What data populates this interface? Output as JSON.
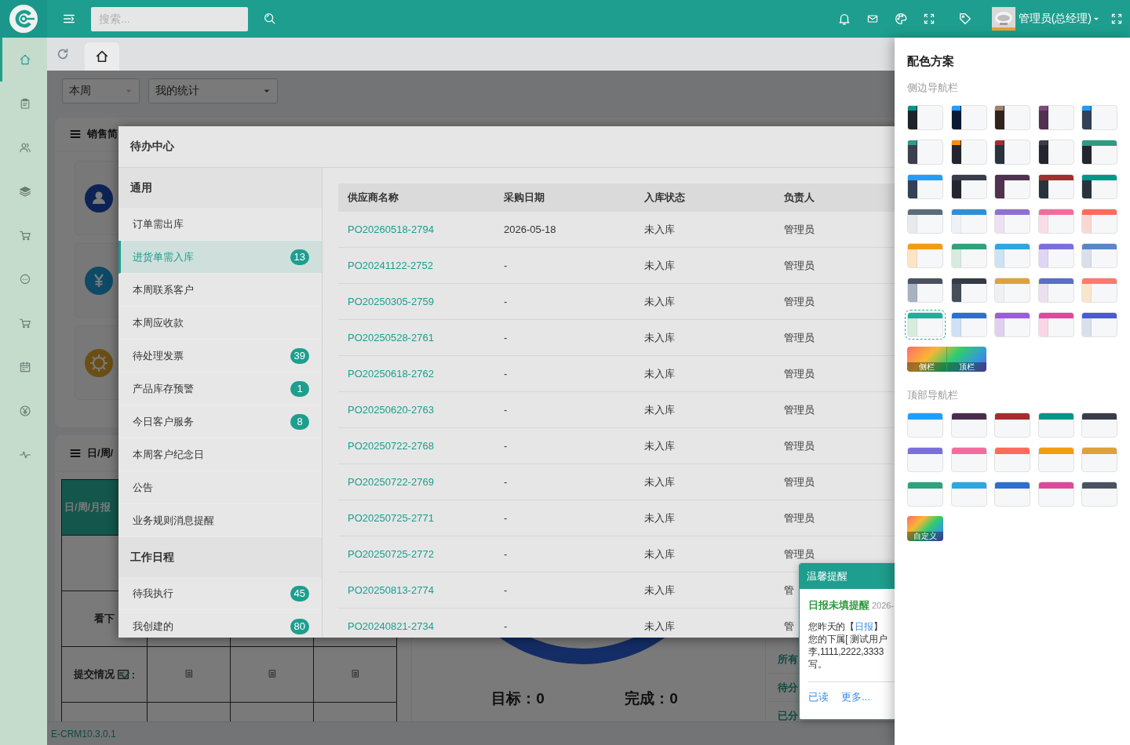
{
  "topbar": {
    "search": {
      "placeholder": "搜索..."
    },
    "user": {
      "name": "管理员(总经理)"
    }
  },
  "sidebar": {
    "items": [
      {
        "selected": true
      },
      {
        "selected": false
      },
      {
        "selected": false
      },
      {
        "selected": false
      },
      {
        "selected": false
      },
      {
        "selected": false
      },
      {
        "selected": false
      },
      {
        "selected": false
      },
      {
        "selected": false
      },
      {
        "selected": false
      }
    ]
  },
  "tabs": [
    {
      "selected": true
    }
  ],
  "dashboard": {
    "filters": [
      {
        "value": "本周"
      },
      {
        "value": "我的统计"
      }
    ],
    "sales_card": {
      "title": "销售简"
    },
    "report_card": {
      "title": "日/周/",
      "table": {
        "header": "日/周/月报",
        "rows": [
          {
            "label": "看下"
          },
          {
            "label": "提交情况",
            "suffix": ":"
          }
        ]
      },
      "target": "目标：0",
      "done": "完成：0",
      "list": [
        "所有",
        "待分",
        "已分"
      ]
    }
  },
  "footer": {
    "version": "E-CRM10.3.0.1"
  },
  "todo_dialog": {
    "title": "待办中心",
    "nav": [
      {
        "group": "通用",
        "items": [
          {
            "label": "订单需出库",
            "selected": false
          },
          {
            "label": "进货单需入库",
            "selected": true,
            "count": "13"
          },
          {
            "label": "本周联系客户",
            "selected": false
          },
          {
            "label": "本周应收款",
            "selected": false
          },
          {
            "label": "待处理发票",
            "selected": false,
            "count": "39"
          },
          {
            "label": "产品库存预警",
            "selected": false,
            "count": "1"
          },
          {
            "label": "今日客户服务",
            "selected": false,
            "count": "8"
          },
          {
            "label": "本周客户纪念日",
            "selected": false
          },
          {
            "label": "公告",
            "selected": false
          },
          {
            "label": "业务规则消息提醒",
            "selected": false
          }
        ]
      },
      {
        "group": "工作日程",
        "items": [
          {
            "label": "待我执行",
            "selected": false,
            "count": "45"
          },
          {
            "label": "我创建的",
            "selected": false,
            "count": "80"
          }
        ]
      }
    ],
    "table": {
      "columns": [
        "供应商名称",
        "采购日期",
        "入库状态",
        "负责人"
      ],
      "rows": [
        [
          "PO20260518-2794",
          "2026-05-18",
          "未入库",
          "管理员"
        ],
        [
          "PO20241122-2752",
          "-",
          "未入库",
          "管理员"
        ],
        [
          "PO20250305-2759",
          "-",
          "未入库",
          "管理员"
        ],
        [
          "PO20250528-2761",
          "-",
          "未入库",
          "管理员"
        ],
        [
          "PO20250618-2762",
          "-",
          "未入库",
          "管理员"
        ],
        [
          "PO20250620-2763",
          "-",
          "未入库",
          "管理员"
        ],
        [
          "PO20250722-2768",
          "-",
          "未入库",
          "管理员"
        ],
        [
          "PO20250722-2769",
          "-",
          "未入库",
          "管理员"
        ],
        [
          "PO20250725-2771",
          "-",
          "未入库",
          "管理员"
        ],
        [
          "PO20250725-2772",
          "-",
          "未入库",
          "管理员"
        ],
        [
          "PO20250813-2774",
          "-",
          "未入库",
          "管"
        ],
        [
          "PO20240821-2734",
          "-",
          "未入库",
          "管"
        ]
      ]
    }
  },
  "theme_panel": {
    "title": "配色方案",
    "side_label": "侧边导航栏",
    "side_swatches": [
      {
        "kind": "corner",
        "color": "#009688",
        "sidebar": {
          "color": "#20222a"
        },
        "selected": false
      },
      {
        "kind": "corner",
        "color": "#1e9fff",
        "sidebar": {
          "color": "#0a1a33"
        },
        "selected": false
      },
      {
        "kind": "corner",
        "color": "#a0826d",
        "sidebar": {
          "color": "#2e241c"
        },
        "selected": false
      },
      {
        "kind": "corner",
        "color": "#7a4a7a",
        "sidebar": {
          "color": "#50314f"
        },
        "selected": false
      },
      {
        "kind": "corner",
        "color": "#1e9fff",
        "sidebar": {
          "color": "#344058"
        },
        "selected": false
      },
      {
        "kind": "corner",
        "color": "#2e9c88",
        "sidebar": {
          "color": "#3d3f4e"
        },
        "selected": false
      },
      {
        "kind": "corner",
        "color": "#ff8c00",
        "sidebar": {
          "color": "#23262e"
        },
        "selected": false
      },
      {
        "kind": "corner",
        "color": "#a62d2d",
        "sidebar": {
          "color": "#28333e"
        },
        "selected": false
      },
      {
        "kind": "corner",
        "color": "#3b3e4a",
        "sidebar": {
          "color": "#23262e"
        },
        "selected": false
      },
      {
        "kind": "bar",
        "color": "#2e9c80",
        "sidebar": {
          "color": "#23262e"
        },
        "selected": false
      },
      {
        "kind": "bar",
        "color": "#1e9fff",
        "sidebar": {
          "color": "#344058"
        },
        "selected": false
      },
      {
        "kind": "bar",
        "color": "#393d49",
        "sidebar": {
          "color": "#23262e"
        },
        "selected": false
      },
      {
        "kind": "bar",
        "color": "#50314f",
        "sidebar": {
          "color": "#50314f"
        },
        "selected": false
      },
      {
        "kind": "bar",
        "color": "#a62d2d",
        "sidebar": {
          "color": "#28333e"
        },
        "selected": false
      },
      {
        "kind": "bar",
        "color": "#009688",
        "sidebar": {
          "color": "#28333e"
        },
        "selected": false
      },
      {
        "kind": "bar",
        "color": "#5b6b7c",
        "sidebar": {
          "color": "#e8eaed"
        },
        "selected": false
      },
      {
        "kind": "bar",
        "color": "#2b90d9",
        "sidebar": {
          "color": "#eef2f6"
        },
        "selected": false
      },
      {
        "kind": "bar",
        "color": "#8e6fd6",
        "sidebar": {
          "color": "#ede0f0"
        },
        "selected": false
      },
      {
        "kind": "bar",
        "color": "#f26d9e",
        "sidebar": {
          "color": "#fbdbe6"
        },
        "selected": false
      },
      {
        "kind": "bar",
        "color": "#ff6b5a",
        "sidebar": {
          "color": "#f9d8d2"
        },
        "selected": false
      },
      {
        "kind": "bar",
        "color": "#f39c12",
        "sidebar": {
          "color": "#fbe5c6"
        },
        "selected": false
      },
      {
        "kind": "bar",
        "color": "#2ea27a",
        "sidebar": {
          "color": "#d6ebdd"
        },
        "selected": false
      },
      {
        "kind": "bar",
        "color": "#2da7e0",
        "sidebar": {
          "color": "#cde2f5"
        },
        "selected": false
      },
      {
        "kind": "bar",
        "color": "#7b6fe0",
        "sidebar": {
          "color": "#e0d5f2"
        },
        "selected": false
      },
      {
        "kind": "bar",
        "color": "#5a86c5",
        "sidebar": {
          "color": "#d9e0ea"
        },
        "selected": false
      },
      {
        "kind": "bar",
        "color": "#4a5261",
        "sidebar": {
          "color": "#a8b2c0"
        },
        "selected": false
      },
      {
        "kind": "bar",
        "color": "#353a47",
        "sidebar": {
          "color": "#474e5b"
        },
        "selected": false
      },
      {
        "kind": "bar",
        "color": "#e0a03a",
        "sidebar": {
          "color": "#eef0f2"
        },
        "selected": false
      },
      {
        "kind": "bar",
        "color": "#5b6ec8",
        "sidebar": {
          "color": "#ece0f0"
        },
        "selected": false
      },
      {
        "kind": "bar",
        "color": "#ff7a68",
        "sidebar": {
          "color": "#f9e6cc"
        },
        "selected": false
      },
      {
        "kind": "bar",
        "color": "#1fae9a",
        "sidebar": {
          "color": "#d6ecdc"
        },
        "selected": true
      },
      {
        "kind": "bar",
        "color": "#2c6fd0",
        "sidebar": {
          "color": "#cde0f4"
        },
        "selected": false
      },
      {
        "kind": "bar",
        "color": "#9a5ce0",
        "sidebar": {
          "color": "#e0d0f0"
        },
        "selected": false
      },
      {
        "kind": "bar",
        "color": "#e0489c",
        "sidebar": {
          "color": "#f9d6e6"
        },
        "selected": false
      },
      {
        "kind": "bar",
        "color": "#4b5ad6",
        "sidebar": {
          "color": "#d9e0ea"
        },
        "selected": false
      }
    ],
    "side_custom": {
      "labels": [
        "侧栏",
        "顶栏"
      ]
    },
    "top_label": "顶部导航栏",
    "top_swatches": [
      {
        "color": "#1e9fff",
        "selected": false
      },
      {
        "color": "#4a2d4e",
        "selected": false
      },
      {
        "color": "#a62d2d",
        "selected": false
      },
      {
        "color": "#009688",
        "selected": false
      },
      {
        "color": "#393d49",
        "selected": false
      },
      {
        "color": "#7b6fe0",
        "selected": false
      },
      {
        "color": "#f26d9e",
        "selected": false
      },
      {
        "color": "#ff6b5a",
        "selected": false
      },
      {
        "color": "#f39c12",
        "selected": false
      },
      {
        "color": "#e0a03a",
        "selected": false
      },
      {
        "color": "#2ea27a",
        "selected": false
      },
      {
        "color": "#2da7e0",
        "selected": false
      },
      {
        "color": "#2c6fd0",
        "selected": false
      },
      {
        "color": "#e0489c",
        "selected": false
      },
      {
        "color": "#4a5261",
        "selected": false
      }
    ],
    "top_custom": {
      "label": "自定义"
    }
  },
  "notice": {
    "title": "温馨提醒",
    "heading": "日报未填提醒",
    "date": "2026-",
    "message_start": {
      "text": "您昨天的【",
      "link": "日报",
      "text_after": "】"
    },
    "message_lines": [
      "您的下属[ 测试用户",
      "李,1111,2222,3333",
      "写。"
    ],
    "actions": [
      "已读",
      "更多..."
    ]
  }
}
